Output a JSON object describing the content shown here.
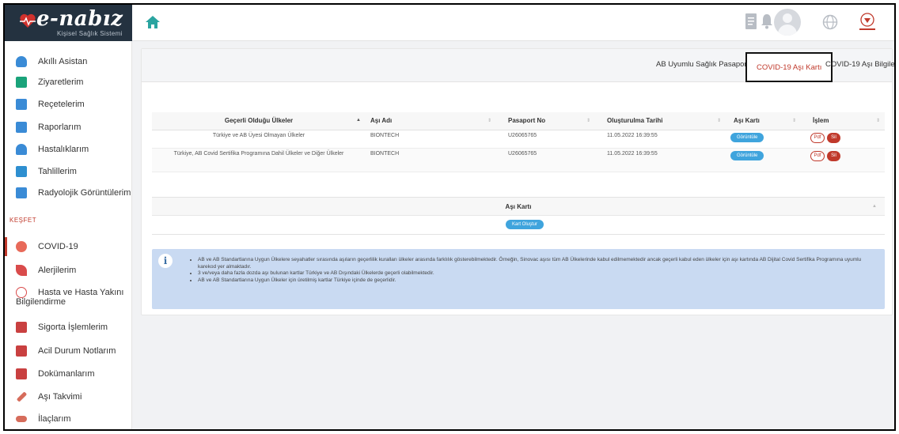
{
  "brand": {
    "name": "e-nabız",
    "subtitle": "Kişisel Sağlık Sistemi"
  },
  "topbar": {
    "icons": [
      "home-icon",
      "document-icon",
      "bell-icon",
      "avatar",
      "globe-icon",
      "ministry-logo-icon"
    ]
  },
  "sidebar": {
    "items": [
      {
        "label": "Akıllı Asistan",
        "icon": "assistant-icon",
        "color": "#3a8bd6"
      },
      {
        "label": "Ziyaretlerim",
        "icon": "building-icon",
        "color": "#1aa37a"
      },
      {
        "label": "Reçetelerim",
        "icon": "prescription-icon",
        "color": "#3a8bd6"
      },
      {
        "label": "Raporlarım",
        "icon": "report-icon",
        "color": "#3a8bd6"
      },
      {
        "label": "Hastalıklarım",
        "icon": "patient-icon",
        "color": "#3a8bd6"
      },
      {
        "label": "Tahlillerim",
        "icon": "lab-icon",
        "color": "#2e8fd0"
      },
      {
        "label": "Radyolojik Görüntülerim",
        "icon": "radiology-icon",
        "color": "#3a8bd6"
      }
    ],
    "section_label": "KEŞFET",
    "explore_items": [
      {
        "label": "COVID-19",
        "icon": "virus-icon",
        "color": "#e86a5a"
      },
      {
        "label": "Alerjilerim",
        "icon": "allergy-icon",
        "color": "#d94b4b"
      },
      {
        "label": "Hasta ve Hasta Yakını",
        "label2": "Bilgilendirme",
        "icon": "heart-outline-icon",
        "color": "#d94b4b"
      },
      {
        "label": "Sigorta İşlemlerim",
        "icon": "insurance-icon",
        "color": "#c94040"
      },
      {
        "label": "Acil Durum Notlarım",
        "icon": "notes-icon",
        "color": "#c94040"
      },
      {
        "label": "Dokümanlarım",
        "icon": "documents-icon",
        "color": "#c94040"
      },
      {
        "label": "Aşı Takvimi",
        "icon": "syringe-icon",
        "color": "#d66c5b"
      },
      {
        "label": "İlaçlarım",
        "icon": "pills-icon",
        "color": "#d66c5b"
      }
    ]
  },
  "tabs": [
    {
      "label": "AB Uyumlu Sağlık Pasaportu",
      "selected": false
    },
    {
      "label": "COVID-19 Aşı Kartı",
      "selected": true
    },
    {
      "label": "COVID-19 Aşı Bilgileri",
      "selected": false
    }
  ],
  "table": {
    "headers": [
      "Geçerli Olduğu Ülkeler",
      "Aşı Adı",
      "Pasaport No",
      "Oluşturulma Tarihi",
      "Aşı Kartı",
      "İşlem"
    ],
    "rows": [
      {
        "countries": "Türkiye ve AB Üyesi Olmayan Ülkeler",
        "vaccine": "BIONTECH",
        "passport": "U26065765",
        "created": "11.05.2022 16:39:55",
        "card_btn": "Görüntüle",
        "pdf_btn": "Pdf",
        "delete_btn": "Sil"
      },
      {
        "countries": "Türkiye, AB Covid Sertifika Programına Dahil Ülkeler ve Diğer Ülkeler",
        "vaccine": "BIONTECH",
        "passport": "U26065765",
        "created": "11.05.2022 16:39:55",
        "card_btn": "Görüntüle",
        "pdf_btn": "Pdf",
        "delete_btn": "Sil"
      }
    ]
  },
  "card_section": {
    "title": "Aşı Kartı",
    "create_btn": "Kart Oluştur"
  },
  "info": {
    "lines": [
      "AB ve AB Standartlarına Uygun Ülkelere seyahatler sırasında aşıların geçerlilik kuralları ülkeler arasında farklılık gösterebilmektedir. Örneğin, Sinovac aşısı tüm AB Ülkelerinde kabul edilmemektedir ancak geçerli kabul eden ülkeler için aşı kartında AB Dijital Covid Sertifika Programına uyumlu karekod yer almaktadır.",
      "3 ve/veya daha fazla dozda aşı bulunan kartlar Türkiye ve AB Dışındaki Ülkelerde geçerli olabilmektedir.",
      "AB ve AB Standartlarına Uygun Ülkeler için üretilmiş kartlar Türkiye içinde de geçerlidir."
    ]
  },
  "colors": {
    "brand_dark": "#243240",
    "accent_red": "#c0392b",
    "button_blue": "#3fa4dd",
    "info_bg": "#c9daf2"
  }
}
